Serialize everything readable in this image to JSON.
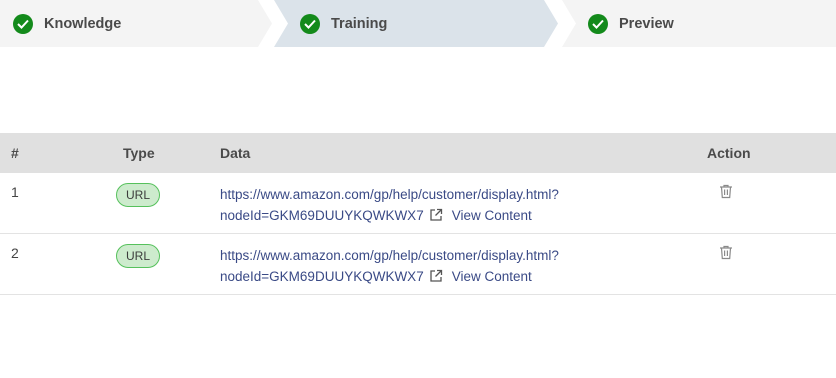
{
  "stepper": {
    "steps": [
      {
        "label": "Knowledge",
        "state": "done",
        "icon": "check-circle-icon"
      },
      {
        "label": "Training",
        "state": "active",
        "icon": "check-circle-icon"
      },
      {
        "label": "Preview",
        "state": "done",
        "icon": "check-circle-icon"
      }
    ],
    "colors": {
      "inactive_bg": "#f4f4f4",
      "active_bg": "#dbe3ea",
      "check": "#138a1b"
    }
  },
  "table": {
    "headers": {
      "num": "#",
      "type": "Type",
      "data": "Data",
      "action": "Action"
    },
    "rows": [
      {
        "num": "1",
        "type": "URL",
        "url_line1": "https://www.amazon.com/gp/help/customer/display.html?",
        "url_line2": "nodeId=GKM69DUUYKQWKWX7",
        "view_label": "View Content",
        "action_icon": "trash-icon"
      },
      {
        "num": "2",
        "type": "URL",
        "url_line1": "https://www.amazon.com/gp/help/customer/display.html?",
        "url_line2": "nodeId=GKM69DUUYKQWKWX7",
        "view_label": "View Content",
        "action_icon": "trash-icon"
      }
    ]
  }
}
